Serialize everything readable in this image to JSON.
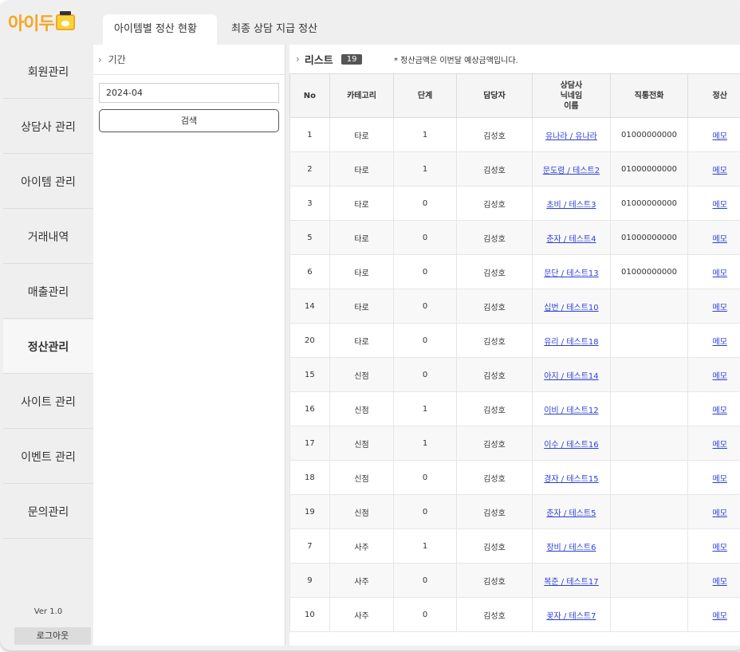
{
  "logo": "아이두",
  "tabs": [
    {
      "label": "아이템별 정산 현황",
      "active": true
    },
    {
      "label": "최종 상담 지급 정산",
      "active": false
    }
  ],
  "sidebar": {
    "items": [
      {
        "label": "회원관리"
      },
      {
        "label": "상담사 관리"
      },
      {
        "label": "아이템 관리"
      },
      {
        "label": "거래내역"
      },
      {
        "label": "매출관리"
      },
      {
        "label": "정산관리",
        "active": true
      },
      {
        "label": "사이트 관리"
      },
      {
        "label": "이벤트 관리"
      },
      {
        "label": "문의관리"
      }
    ],
    "version": "Ver 1.0",
    "logout_label": "로그아웃"
  },
  "filter": {
    "title": "기간",
    "date_value": "2024-04",
    "search_label": "검색"
  },
  "list": {
    "title": "리스트",
    "count": "19",
    "notice": "* 정산금액은 이번달 예상금액입니다.",
    "columns": [
      "No",
      "카테고리",
      "단계",
      "담당자",
      "상담사\n닉네임\n이름",
      "직통전화",
      "정산"
    ],
    "rows": [
      {
        "no": "1",
        "category": "타로",
        "level": "1",
        "manager": "김성호",
        "counselor": "유나라 / 유나라",
        "phone": "01000000000",
        "memo": "메모"
      },
      {
        "no": "2",
        "category": "타로",
        "level": "1",
        "manager": "김성호",
        "counselor": "문도령 / 테스트2",
        "phone": "01000000000",
        "memo": "메모"
      },
      {
        "no": "3",
        "category": "타로",
        "level": "0",
        "manager": "김성호",
        "counselor": "초비 / 테스트3",
        "phone": "01000000000",
        "memo": "메모"
      },
      {
        "no": "5",
        "category": "타로",
        "level": "0",
        "manager": "김성호",
        "counselor": "춘자 / 테스트4",
        "phone": "01000000000",
        "memo": "메모"
      },
      {
        "no": "6",
        "category": "타로",
        "level": "0",
        "manager": "김성호",
        "counselor": "문단 / 테스트13",
        "phone": "01000000000",
        "memo": "메모"
      },
      {
        "no": "14",
        "category": "타로",
        "level": "0",
        "manager": "김성호",
        "counselor": "십번 / 테스트10",
        "phone": "",
        "memo": "메모"
      },
      {
        "no": "20",
        "category": "타로",
        "level": "0",
        "manager": "김성호",
        "counselor": "유리 / 테스트18",
        "phone": "",
        "memo": "메모"
      },
      {
        "no": "15",
        "category": "신점",
        "level": "0",
        "manager": "김성호",
        "counselor": "아지 / 테스트14",
        "phone": "",
        "memo": "메모"
      },
      {
        "no": "16",
        "category": "신점",
        "level": "1",
        "manager": "김성호",
        "counselor": "이비 / 테스트12",
        "phone": "",
        "memo": "메모"
      },
      {
        "no": "17",
        "category": "신점",
        "level": "1",
        "manager": "김성호",
        "counselor": "이수 / 테스트16",
        "phone": "",
        "memo": "메모"
      },
      {
        "no": "18",
        "category": "신점",
        "level": "0",
        "manager": "김성호",
        "counselor": "경자 / 테스트15",
        "phone": "",
        "memo": "메모"
      },
      {
        "no": "19",
        "category": "신점",
        "level": "0",
        "manager": "김성호",
        "counselor": "춘자 / 테스트5",
        "phone": "",
        "memo": "메모"
      },
      {
        "no": "7",
        "category": "사주",
        "level": "1",
        "manager": "김성호",
        "counselor": "장비 / 테스트6",
        "phone": "",
        "memo": "메모"
      },
      {
        "no": "9",
        "category": "사주",
        "level": "0",
        "manager": "김성호",
        "counselor": "복준 / 테스트17",
        "phone": "",
        "memo": "메모"
      },
      {
        "no": "10",
        "category": "사주",
        "level": "0",
        "manager": "김성호",
        "counselor": "꽃자 / 테스트7",
        "phone": "",
        "memo": "메모"
      }
    ]
  }
}
